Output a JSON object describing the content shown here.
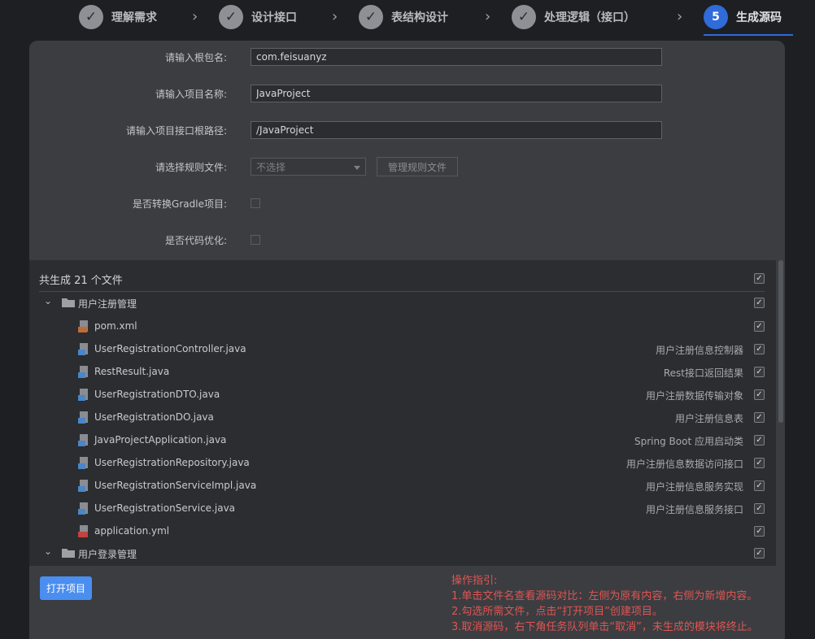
{
  "steps": [
    {
      "label": "理解需求",
      "status": "done",
      "mark": "✓"
    },
    {
      "label": "设计接口",
      "status": "done",
      "mark": "✓"
    },
    {
      "label": "表结构设计",
      "status": "done",
      "mark": "✓"
    },
    {
      "label": "处理逻辑（接口）",
      "status": "done",
      "mark": "✓"
    },
    {
      "label": "生成源码",
      "status": "active",
      "mark": "5"
    }
  ],
  "form": {
    "package": {
      "label": "请输入根包名:",
      "value": "com.feisuanyz"
    },
    "project": {
      "label": "请输入项目名称:",
      "value": "JavaProject"
    },
    "root_path": {
      "label": "请输入项目接口根路径:",
      "value": "/JavaProject"
    },
    "rule_file": {
      "label": "请选择规则文件:",
      "placeholder": "不选择",
      "manage_button": "管理规则文件"
    },
    "gradle": {
      "label": "是否转换Gradle项目:"
    },
    "optimize": {
      "label": "是否代码优化:"
    }
  },
  "files": {
    "summary": "共生成 21 个文件",
    "groups": [
      {
        "name": "用户注册管理",
        "items": [
          {
            "name": "pom.xml",
            "desc": "",
            "icon": "xml-file-icon"
          },
          {
            "name": "UserRegistrationController.java",
            "desc": "用户注册信息控制器",
            "icon": "java-file-icon"
          },
          {
            "name": "RestResult.java",
            "desc": "Rest接口返回结果",
            "icon": "java-file-icon"
          },
          {
            "name": "UserRegistrationDTO.java",
            "desc": "用户注册数据传输对象",
            "icon": "java-file-icon"
          },
          {
            "name": "UserRegistrationDO.java",
            "desc": "用户注册信息表",
            "icon": "java-file-icon"
          },
          {
            "name": "JavaProjectApplication.java",
            "desc": "Spring Boot 应用启动类",
            "icon": "java-file-icon"
          },
          {
            "name": "UserRegistrationRepository.java",
            "desc": "用户注册信息数据访问接口",
            "icon": "java-file-icon"
          },
          {
            "name": "UserRegistrationServiceImpl.java",
            "desc": "用户注册信息服务实现",
            "icon": "java-file-icon"
          },
          {
            "name": "UserRegistrationService.java",
            "desc": "用户注册信息服务接口",
            "icon": "java-file-icon"
          },
          {
            "name": "application.yml",
            "desc": "",
            "icon": "yml-file-icon"
          }
        ]
      },
      {
        "name": "用户登录管理",
        "items": []
      }
    ]
  },
  "footer": {
    "open_button": "打开项目",
    "guide": [
      "操作指引:",
      "1.单击文件名查看源码对比：左侧为原有内容，右侧为新增内容。",
      "2.勾选所需文件，点击“打开项目”创建项目。",
      "3.取消源码，右下角任务队列单击“取消”，未生成的模块将终止。"
    ]
  },
  "colors": {
    "accent": "#2f6bd9",
    "button": "#4a8ef0",
    "guide_text": "#e05552"
  }
}
